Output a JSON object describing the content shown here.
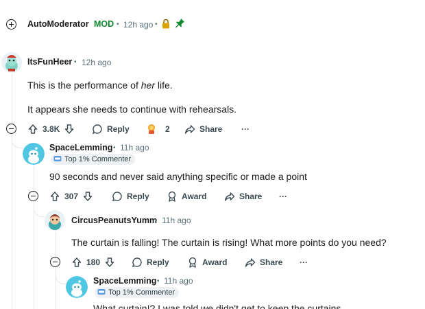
{
  "automod": {
    "username": "AutoModerator",
    "mod_badge": "MOD",
    "time": "12h ago",
    "icons": [
      "lock-icon",
      "pin-icon"
    ]
  },
  "comment1": {
    "username": "ItsFunHeer",
    "time": "12h ago",
    "line1_pre": "This is the performance of ",
    "line1_em": "her",
    "line1_post": " life.",
    "line2": "It appears she needs to continue with rehearsals.",
    "votes": "3.8K",
    "reply": "Reply",
    "award_count": "2",
    "share": "Share",
    "more": "···"
  },
  "comment2": {
    "username": "SpaceLemming",
    "time": "11h ago",
    "flair": "Top 1% Commenter",
    "text": "90 seconds and never said anything specific or made a point",
    "votes": "307",
    "reply": "Reply",
    "award": "Award",
    "share": "Share",
    "more": "···"
  },
  "comment3": {
    "username": "CircusPeanutsYumm",
    "time": "11h ago",
    "text": "The curtain is falling! The curtain is rising! What more points do you need?",
    "votes": "180",
    "reply": "Reply",
    "award": "Award",
    "share": "Share",
    "more": "···"
  },
  "comment4": {
    "username": "SpaceLemming",
    "time": "11h ago",
    "flair": "Top 1% Commenter",
    "text_partial": "What curtain!? I was told we didn't get to keep the curtains"
  },
  "colors": {
    "mod_green": "#0f8a2f",
    "meta_gray": "#576f76",
    "thread_line": "#e3e6e8",
    "flair_bg": "#eef1f3"
  },
  "separator": "•"
}
